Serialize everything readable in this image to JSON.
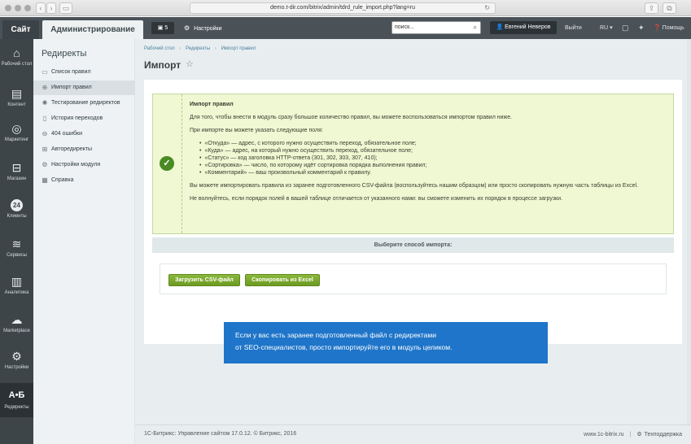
{
  "browser": {
    "url": "demo.t-dir.com/bitrix/admin/tdrd_rule_import.php?lang=ru"
  },
  "topbar": {
    "site_tab": "Сайт",
    "admin_tab": "Администрирование",
    "notifications_count": "5",
    "settings_label": "Настройки",
    "search_value": "поиск...",
    "user_name": "Евгений Неверов",
    "logout_label": "Выйти",
    "language": "RU",
    "help_label": "Помощь"
  },
  "leftnav": {
    "items": [
      {
        "label": "Рабочий стол",
        "icon": "home-icon"
      },
      {
        "label": "Контент",
        "icon": "content-icon"
      },
      {
        "label": "Маркетинг",
        "icon": "target-icon"
      },
      {
        "label": "Магазин",
        "icon": "cart-icon"
      },
      {
        "label": "Клиенты",
        "icon": "clients-24-icon",
        "badge": "24"
      },
      {
        "label": "Сервисы",
        "icon": "layers-icon"
      },
      {
        "label": "Аналитика",
        "icon": "bar-chart-icon"
      },
      {
        "label": "Marketplace",
        "icon": "cloud-download-icon"
      },
      {
        "label": "Настройки",
        "icon": "gear-icon"
      },
      {
        "label": "Редиректы",
        "icon": "ab-icon",
        "glyph": "A•Б"
      }
    ]
  },
  "submenu": {
    "title": "Редиректы",
    "items": [
      {
        "label": "Список правил",
        "icon": "list-icon"
      },
      {
        "label": "Импорт правил",
        "icon": "import-icon"
      },
      {
        "label": "Тестирование редиректов",
        "icon": "bulb-icon"
      },
      {
        "label": "История переходов",
        "icon": "history-icon"
      },
      {
        "label": "404 ошибки",
        "icon": "minus-circle-icon"
      },
      {
        "label": "Авторедиректы",
        "icon": "auto-redirect-icon"
      },
      {
        "label": "Настройки модуля",
        "icon": "settings-icon"
      },
      {
        "label": "Справка",
        "icon": "help-book-icon"
      }
    ]
  },
  "breadcrumbs": [
    "Рабочий стол",
    "Редиректы",
    "Импорт правил"
  ],
  "breadcrumb_sep": "›",
  "page_title": "Импорт",
  "notice": {
    "title": "Импорт правил",
    "intro": "Для того, чтобы внести в модуль сразу большое количество правил, вы можете воспользоваться импортом правил ниже.",
    "fields_intro": "При импорте вы можете указать следующие поля:",
    "fields": [
      "«Откуда» — адрес, с которого нужно осуществить переход, обязательное поле;",
      "«Куда» — адрес, на который нужно осуществить переход, обязательное поле;",
      "«Статус» — код заголовка HTTP-ответа (301, 302, 303, 307, 410);",
      "«Сортировка» — число, по которому идёт сортировка порядка выполнения правил;",
      "«Комментарий» — ваш произвольный комментарий к правилу."
    ],
    "csv_note": "Вы можете импортировать правила из заранее подготовленного CSV-файла (воспользуйтесь нашим образцом) или просто скопировать нужную часть таблицы из Excel.",
    "order_note": "Не волнуйтесь, если порядок полей в вашей таблице отличается от указанного нами: вы сможете изменить их порядок в процессе загрузки."
  },
  "choose_label": "Выберите способ импорта:",
  "buttons": {
    "upload_csv": "Загрузить CSV-файл",
    "copy_excel": "Скопировать из Excel"
  },
  "tooltip": {
    "line1": "Если у вас есть заранее подготовленный файл с редиректами",
    "line2": "от SEO-специалистов, просто импортируйте его в модуль целиком."
  },
  "footer": {
    "left": "1С-Битрикс: Управление сайтом 17.0.12. © Битрикс, 2016",
    "site_link": "www.1c-bitrix.ru",
    "support_link": "Техподдержка"
  }
}
